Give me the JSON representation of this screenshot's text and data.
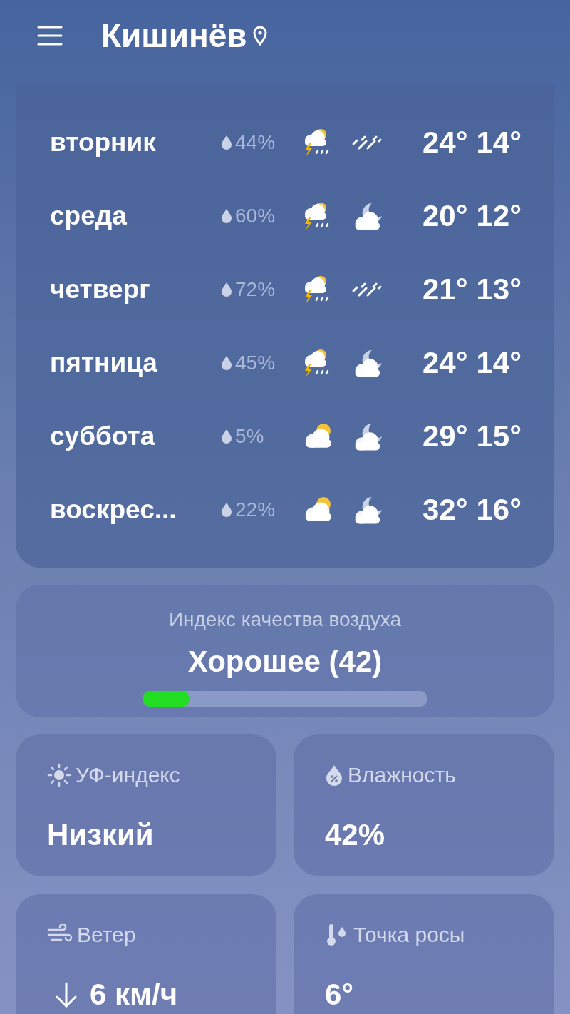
{
  "header": {
    "city": "Кишинёв"
  },
  "forecast": [
    {
      "day": "вторник",
      "precip": "44%",
      "day_icon": {
        "kind": "storm"
      },
      "night_icon": {
        "kind": "rain"
      },
      "high": "24°",
      "low": "14°"
    },
    {
      "day": "среда",
      "precip": "60%",
      "day_icon": {
        "kind": "storm"
      },
      "night_icon": {
        "kind": "moon"
      },
      "high": "20°",
      "low": "12°"
    },
    {
      "day": "четверг",
      "precip": "72%",
      "day_icon": {
        "kind": "storm"
      },
      "night_icon": {
        "kind": "rain"
      },
      "high": "21°",
      "low": "13°"
    },
    {
      "day": "пятница",
      "precip": "45%",
      "day_icon": {
        "kind": "storm"
      },
      "night_icon": {
        "kind": "moon"
      },
      "high": "24°",
      "low": "14°"
    },
    {
      "day": "суббота",
      "precip": "5%",
      "day_icon": {
        "kind": "sun"
      },
      "night_icon": {
        "kind": "moon"
      },
      "high": "29°",
      "low": "15°"
    },
    {
      "day": "воскрес...",
      "precip": "22%",
      "day_icon": {
        "kind": "sun"
      },
      "night_icon": {
        "kind": "moon"
      },
      "high": "32°",
      "low": "16°"
    }
  ],
  "air_quality": {
    "title": "Индекс качества воздуха",
    "value": "Хорошее (42)",
    "level": 0.165
  },
  "tiles": [
    {
      "kind": "uv",
      "label": "УФ-индекс",
      "value": "Низкий"
    },
    {
      "kind": "humidity",
      "label": "Влажность",
      "value": "42%"
    },
    {
      "kind": "wind",
      "label": "Ветер",
      "value": "6 км/ч"
    },
    {
      "kind": "dew",
      "label": "Точка росы",
      "value": "6°"
    }
  ]
}
